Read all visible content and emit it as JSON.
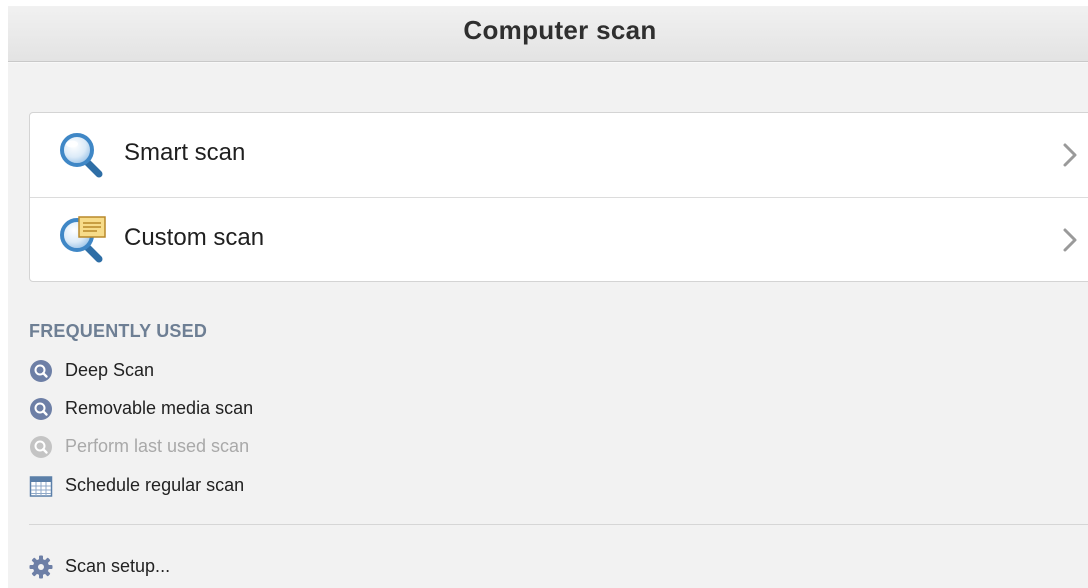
{
  "window": {
    "title": "Computer scan"
  },
  "scans": [
    {
      "label": "Smart scan",
      "icon": "magnifier-icon"
    },
    {
      "label": "Custom scan",
      "icon": "magnifier-note-icon"
    }
  ],
  "frequently_used": {
    "heading": "FREQUENTLY USED",
    "items": [
      {
        "label": "Deep Scan",
        "icon": "search-circle-icon",
        "enabled": true
      },
      {
        "label": "Removable media scan",
        "icon": "search-circle-icon",
        "enabled": true
      },
      {
        "label": "Perform last used scan",
        "icon": "search-circle-icon",
        "enabled": false
      },
      {
        "label": "Schedule regular scan",
        "icon": "calendar-icon",
        "enabled": true
      }
    ]
  },
  "setup": {
    "label": "Scan setup...",
    "icon": "gear-icon"
  },
  "colors": {
    "background": "#f2f2f2",
    "card": "#ffffff",
    "heading": "#6e7f94",
    "icon_blue": "#3f87c6",
    "icon_badge": "#6d7fa6",
    "disabled": "#a9a9a9"
  }
}
